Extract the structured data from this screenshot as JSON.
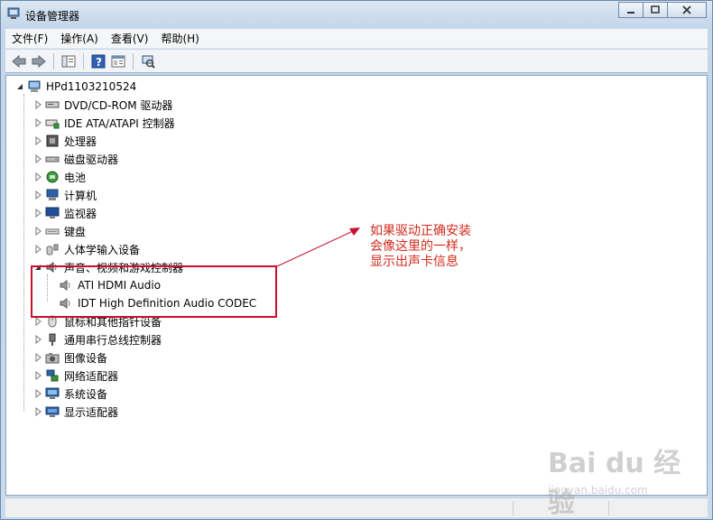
{
  "window": {
    "title": "设备管理器",
    "buttons": [
      "minimize",
      "maximize",
      "close"
    ]
  },
  "menu": [
    "文件(F)",
    "操作(A)",
    "查看(V)",
    "帮助(H)"
  ],
  "toolbar": {
    "buttons": [
      "back-arrow-icon",
      "forward-arrow-icon",
      "show-hide-tree-icon",
      "help-icon",
      "properties-icon",
      "scan-hardware-icon"
    ]
  },
  "tree": {
    "root": "HPd1103210524",
    "items": [
      {
        "label": "DVD/CD-ROM 驱动器",
        "icon": "dvd-drive-icon"
      },
      {
        "label": "IDE ATA/ATAPI 控制器",
        "icon": "ide-controller-icon"
      },
      {
        "label": "处理器",
        "icon": "processor-icon"
      },
      {
        "label": "磁盘驱动器",
        "icon": "disk-drive-icon"
      },
      {
        "label": "电池",
        "icon": "battery-icon"
      },
      {
        "label": "计算机",
        "icon": "computer-icon"
      },
      {
        "label": "监视器",
        "icon": "monitor-icon"
      },
      {
        "label": "键盘",
        "icon": "keyboard-icon"
      },
      {
        "label": "人体学输入设备",
        "icon": "hid-icon"
      },
      {
        "label": "声音、视频和游戏控制器",
        "icon": "sound-icon",
        "expanded": true,
        "children": [
          {
            "label": "ATI HDMI Audio",
            "icon": "speaker-icon"
          },
          {
            "label": "IDT High Definition Audio CODEC",
            "icon": "speaker-icon"
          }
        ]
      },
      {
        "label": "鼠标和其他指针设备",
        "icon": "mouse-icon"
      },
      {
        "label": "通用串行总线控制器",
        "icon": "usb-icon"
      },
      {
        "label": "图像设备",
        "icon": "camera-icon"
      },
      {
        "label": "网络适配器",
        "icon": "network-icon"
      },
      {
        "label": "系统设备",
        "icon": "system-icon"
      },
      {
        "label": "显示适配器",
        "icon": "display-adapter-icon"
      }
    ]
  },
  "annotation": {
    "lines": [
      "如果驱动正确安装",
      "会像这里的一样，",
      "显示出声卡信息"
    ]
  },
  "watermark": {
    "brand": "Bai du 经验",
    "url": "jingyan.baidu.com"
  },
  "colors": {
    "annotation": "#d12b1c",
    "highlight": "#c8102e"
  }
}
